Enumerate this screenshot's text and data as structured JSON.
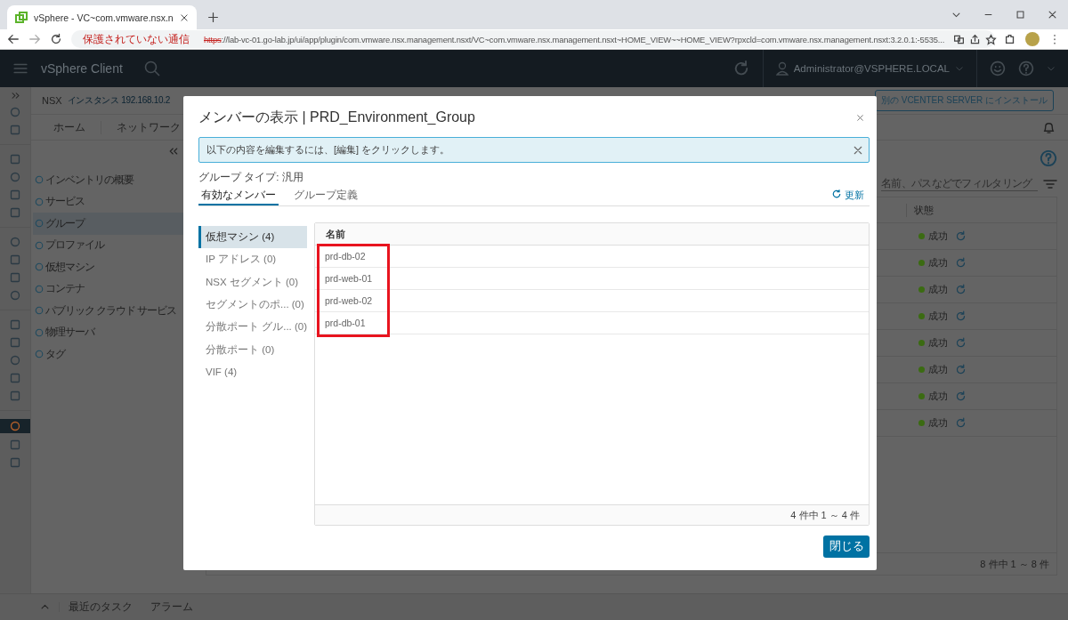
{
  "browser": {
    "tab_title": "vSphere - VC~com.vmware.nsx.n",
    "url_warning": "保護されていない通信",
    "url_scheme": "https",
    "url_rest": "://lab-vc-01.go-lab.jp/ui/app/plugin/com.vmware.nsx.management.nsxt/VC~com.vmware.nsx.management.nsxt~HOME_VIEW~~HOME_VIEW?rpxcld=com.vmware.nsx.management.nsxt:3.2.0.1:-5535..."
  },
  "app_header": {
    "title": "vSphere Client",
    "user": "Administrator@VSPHERE.LOCAL"
  },
  "rail": [
    {
      "selected": false
    },
    {
      "selected": false
    },
    {
      "selected": false
    },
    {
      "selected": false
    },
    {
      "selected": false
    },
    {
      "selected": false
    },
    {
      "selected": false
    },
    {
      "selected": false
    },
    {
      "selected": false
    },
    {
      "selected": false
    },
    {
      "selected": false
    },
    {
      "selected": false
    },
    {
      "selected": false
    },
    {
      "selected": false
    },
    {
      "selected": false
    },
    {
      "selected": true
    },
    {
      "selected": false
    },
    {
      "selected": false
    }
  ],
  "nsx_bar": {
    "label": "NSX",
    "instance": "インスタンス 192.168.10.2",
    "install_button": "別の VCENTER SERVER にインストール"
  },
  "nav_tabs": [
    "ホーム",
    "ネットワーク"
  ],
  "sidebar": {
    "items": [
      {
        "label": "インベントリの概要",
        "selected": false
      },
      {
        "label": "サービス",
        "selected": false
      },
      {
        "label": "グループ",
        "selected": true
      },
      {
        "label": "プロファイル",
        "selected": false
      },
      {
        "label": "仮想マシン",
        "selected": false
      },
      {
        "label": "コンテナ",
        "selected": false
      },
      {
        "label": "パブリック クラウド サービス",
        "selected": false
      },
      {
        "label": "物理サーバ",
        "selected": false
      },
      {
        "label": "タグ",
        "selected": false
      }
    ]
  },
  "filter": {
    "placeholder": "名前、パスなどでフィルタリング"
  },
  "groups_table": {
    "column": "状態",
    "rows": [
      {
        "status": "成功",
        "color": "#3b6b12"
      },
      {
        "status": "成功",
        "color": "#3b6b12"
      },
      {
        "status": "成功",
        "color": "#3b6b12"
      },
      {
        "status": "成功",
        "color": "#3b6b12"
      },
      {
        "status": "成功",
        "color": "#3b6b12"
      },
      {
        "status": "成功",
        "color": "#3b6b12"
      },
      {
        "status": "成功",
        "color": "#3b6b12"
      },
      {
        "status": "成功",
        "color": "#3b6b12"
      }
    ],
    "footer": "8 件中 1 ～ 8 件"
  },
  "bottom_bar": [
    "最近のタスク",
    "アラーム"
  ],
  "modal": {
    "title": "メンバーの表示 | PRD_Environment_Group",
    "info": "以下の内容を編集するには、[編集] をクリックします。",
    "group_type": "グループ タイプ: 汎用",
    "tabs": [
      {
        "label": "有効なメンバー",
        "selected": true
      },
      {
        "label": "グループ定義",
        "selected": false
      }
    ],
    "refresh": "更新",
    "categories": [
      {
        "label": "仮想マシン (4)",
        "selected": true
      },
      {
        "label": "IP アドレス (0)",
        "selected": false
      },
      {
        "label": "NSX セグメント (0)",
        "selected": false
      },
      {
        "label": "セグメントのポ... (0)",
        "selected": false
      },
      {
        "label": "分散ポート グル... (0)",
        "selected": false
      },
      {
        "label": "分散ポート (0)",
        "selected": false
      },
      {
        "label": "VIF (4)",
        "selected": false
      }
    ],
    "table": {
      "column": "名前",
      "highlighted": true,
      "rows": [
        "prd-db-02",
        "prd-web-01",
        "prd-web-02",
        "prd-db-01"
      ],
      "footer": "4 件中 1 ～ 4 件"
    },
    "close_button": "閉じる"
  }
}
